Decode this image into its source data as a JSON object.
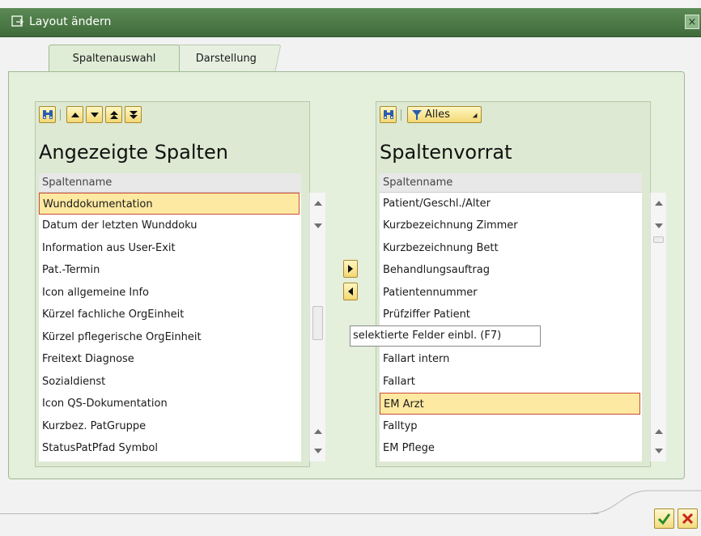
{
  "dialog": {
    "title": "Layout ändern",
    "close_label": "×"
  },
  "tabs": [
    {
      "label": "Spaltenauswahl",
      "active": true
    },
    {
      "label": "Darstellung",
      "active": false
    }
  ],
  "left_panel": {
    "heading": "Angezeigte Spalten",
    "column_header": "Spaltenname",
    "toolbar_icons": [
      "binoculars-icon",
      "arrow-up-icon",
      "arrow-down-icon",
      "move-to-top-icon",
      "move-to-bottom-icon"
    ],
    "rows": [
      "Wunddokumentation",
      "Datum der letzten Wunddoku",
      "Information aus User-Exit",
      "Pat.-Termin",
      "Icon allgemeine Info",
      "Kürzel fachliche OrgEinheit",
      "Kürzel pflegerische OrgEinheit",
      "Freitext Diagnose",
      "Sozialdienst",
      "Icon QS-Dokumentation",
      "Kurzbez. PatGruppe",
      "StatusPatPfad Symbol"
    ],
    "selected_index": 0
  },
  "right_panel": {
    "heading": "Spaltenvorrat",
    "column_header": "Spaltenname",
    "filter_label": "Alles",
    "toolbar_icons": [
      "binoculars-icon",
      "filter-icon"
    ],
    "rows": [
      "Patient/Geschl./Alter",
      "Kurzbezeichnung Zimmer",
      "Kurzbezeichnung Bett",
      "Behandlungsauftrag",
      "Patientennummer",
      "Prüfziffer Patient",
      "",
      "Fallart intern",
      "Fallart",
      "EM Arzt",
      "Falltyp",
      "EM Pflege"
    ],
    "selected_index": 9
  },
  "transfer": {
    "tooltip": "selektierte Felder einbl. (F7)",
    "buttons": [
      "move-right-icon",
      "move-left-icon"
    ]
  },
  "footer": {
    "buttons": [
      "confirm-icon",
      "cancel-icon"
    ]
  },
  "colors": {
    "title_bar": "#4a7645",
    "panel_bg": "#dde9d2",
    "selection_bg": "#fde9a2",
    "selection_border": "#cc4c33",
    "button_gold": "#f3d874"
  }
}
